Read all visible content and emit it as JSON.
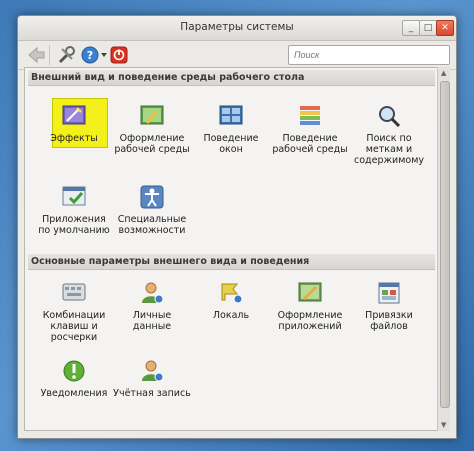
{
  "window": {
    "title": "Параметры системы",
    "controls": {
      "minimize": "_",
      "maximize": "□",
      "close": "✕"
    }
  },
  "toolbar": {
    "search_placeholder": "Поиск"
  },
  "sections": [
    {
      "title": "Внешний вид и поведение среды рабочего стола",
      "items": [
        {
          "label": "Эффекты",
          "selected": true,
          "icon": "effects-icon"
        },
        {
          "label": "Оформление рабочей среды",
          "icon": "workspace-theme-icon"
        },
        {
          "label": "Поведение окон",
          "icon": "window-behavior-icon"
        },
        {
          "label": "Поведение рабочей среды",
          "icon": "workspace-behavior-icon"
        },
        {
          "label": "Поиск по меткам и содержимому",
          "icon": "search-magnifier-icon"
        },
        {
          "label": "Приложения по умолчанию",
          "icon": "default-apps-icon"
        },
        {
          "label": "Специальные возможности",
          "icon": "accessibility-icon"
        }
      ]
    },
    {
      "title": "Основные параметры внешнего вида и поведения",
      "items": [
        {
          "label": "Комбинации клавиш и росчерки",
          "icon": "shortcuts-icon"
        },
        {
          "label": "Личные данные",
          "icon": "personal-info-icon"
        },
        {
          "label": "Локаль",
          "icon": "locale-icon"
        },
        {
          "label": "Оформление приложений",
          "icon": "app-appearance-icon"
        },
        {
          "label": "Привязки файлов",
          "icon": "file-associations-icon"
        },
        {
          "label": "Уведомления",
          "icon": "notifications-icon"
        },
        {
          "label": "Учётная запись",
          "icon": "account-icon"
        }
      ]
    }
  ],
  "colors": {
    "selection": "#f4f11a",
    "accent_close": "#d8472a",
    "desktop": "#3d79b6"
  }
}
